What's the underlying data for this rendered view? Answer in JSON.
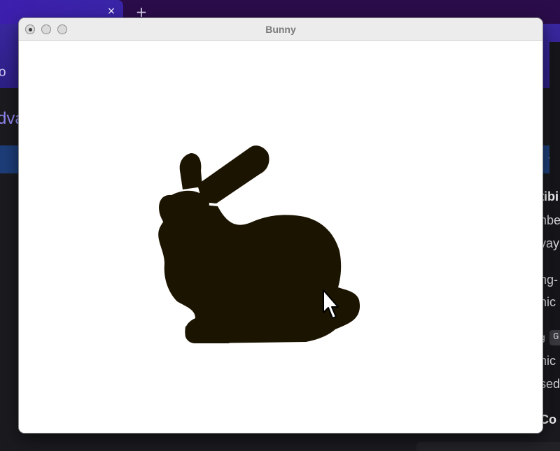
{
  "background_browser": {
    "tab_close_glyph": "×",
    "new_tab_glyph": "+",
    "nav_fragment": "o",
    "heading_fragment": "dva",
    "lines": [
      "tibi",
      "nbe",
      "vay",
      "ng-",
      "hic",
      "g",
      "hic",
      "sed",
      "Co"
    ],
    "code_fragment": "G",
    "colors": {
      "tab_bar": "#2a0c4a",
      "nav": "#3a27a0",
      "banner": "#1d3d78",
      "page": "#1b1a1f"
    }
  },
  "window": {
    "title": "Bunny",
    "controls": [
      "close",
      "minimize",
      "zoom"
    ],
    "colors": {
      "titlebar": "#ececec",
      "canvas": "#ffffff",
      "bunny_fill": "#1b1400"
    }
  },
  "pointer": {
    "icon": "arrow-cursor-icon"
  }
}
